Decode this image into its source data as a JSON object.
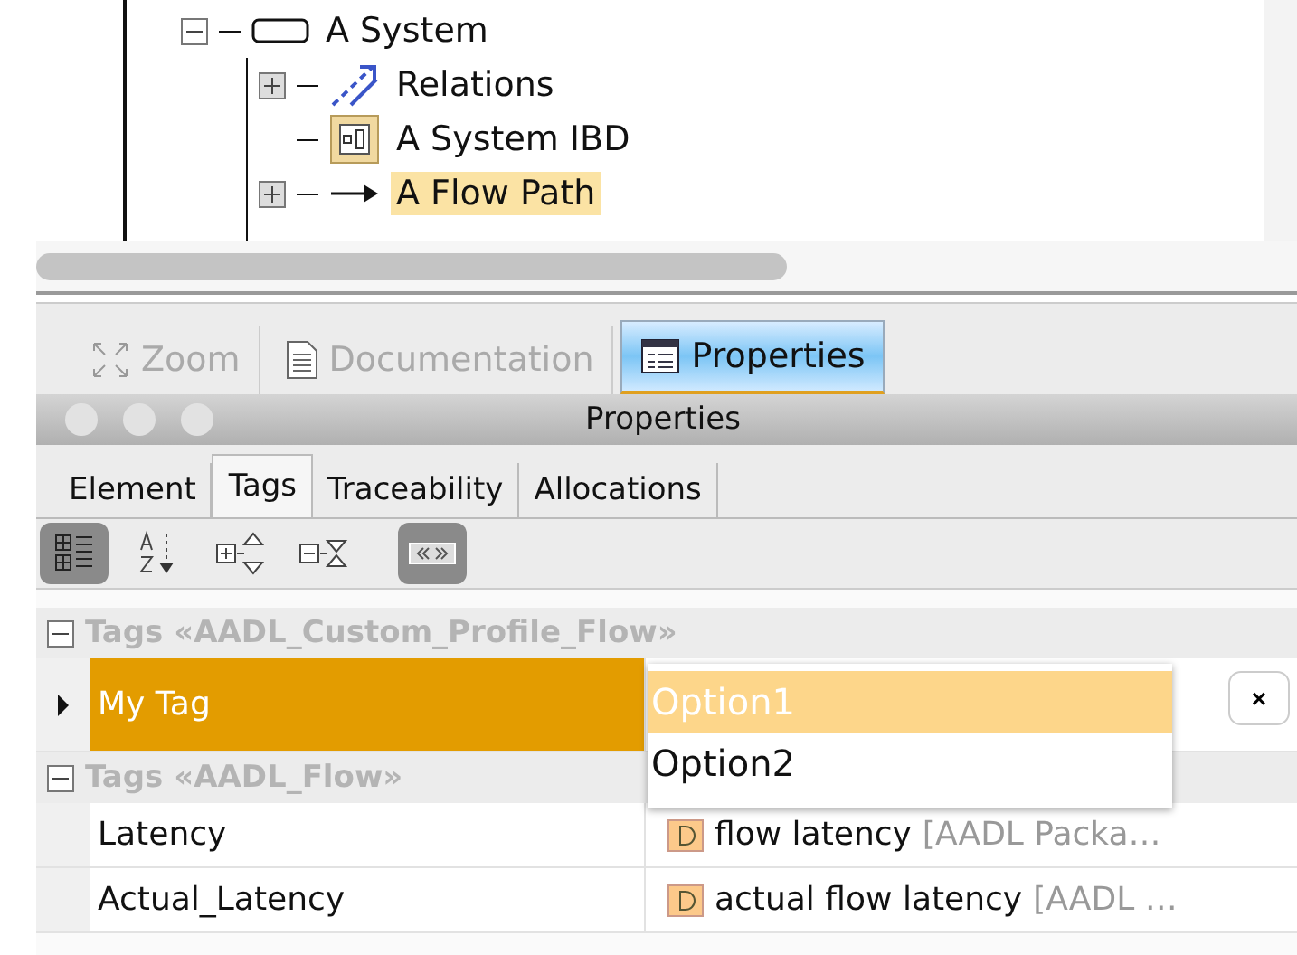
{
  "tree": {
    "items": [
      {
        "label": "A System",
        "kind": "block",
        "expanded": true,
        "selected": false,
        "children": [
          {
            "label": "Relations",
            "kind": "relations",
            "expanded": false,
            "selected": false
          },
          {
            "label": "A System IBD",
            "kind": "diagram",
            "selected": false
          },
          {
            "label": "A Flow Path",
            "kind": "flow",
            "expanded": false,
            "selected": true
          }
        ]
      }
    ]
  },
  "view_tabs": [
    {
      "label": "Zoom",
      "kind": "zoom",
      "selected": false
    },
    {
      "label": "Documentation",
      "kind": "doc",
      "selected": false
    },
    {
      "label": "Properties",
      "kind": "props",
      "selected": true
    }
  ],
  "panel": {
    "title": "Properties",
    "tabs": [
      {
        "label": "Element",
        "selected": false
      },
      {
        "label": "Tags",
        "selected": true
      },
      {
        "label": "Traceability",
        "selected": false
      },
      {
        "label": "Allocations",
        "selected": false
      }
    ],
    "toolbar": [
      {
        "kind": "categorized",
        "pressed": true
      },
      {
        "kind": "sort",
        "pressed": false
      },
      {
        "kind": "expand",
        "pressed": false
      },
      {
        "kind": "collapse",
        "pressed": false
      },
      {
        "kind": "toggle",
        "pressed": true
      }
    ],
    "groups": [
      {
        "title": "Tags «AADL_Custom_Profile_Flow»",
        "expanded": true,
        "rows": [
          {
            "name": "My Tag",
            "selected": true,
            "dropdown": {
              "options": [
                {
                  "label": "Option1",
                  "selected": true
                },
                {
                  "label": "Option2",
                  "selected": false
                }
              ]
            },
            "clear": "×"
          }
        ]
      },
      {
        "title": "Tags «AADL_Flow»",
        "expanded": true,
        "rows": [
          {
            "name": "Latency",
            "selected": false,
            "value": "flow latency",
            "qualifier": "[AADL Packa…"
          },
          {
            "name": "Actual_Latency",
            "selected": false,
            "value": "actual flow latency",
            "qualifier": "[AADL …"
          }
        ]
      }
    ]
  }
}
